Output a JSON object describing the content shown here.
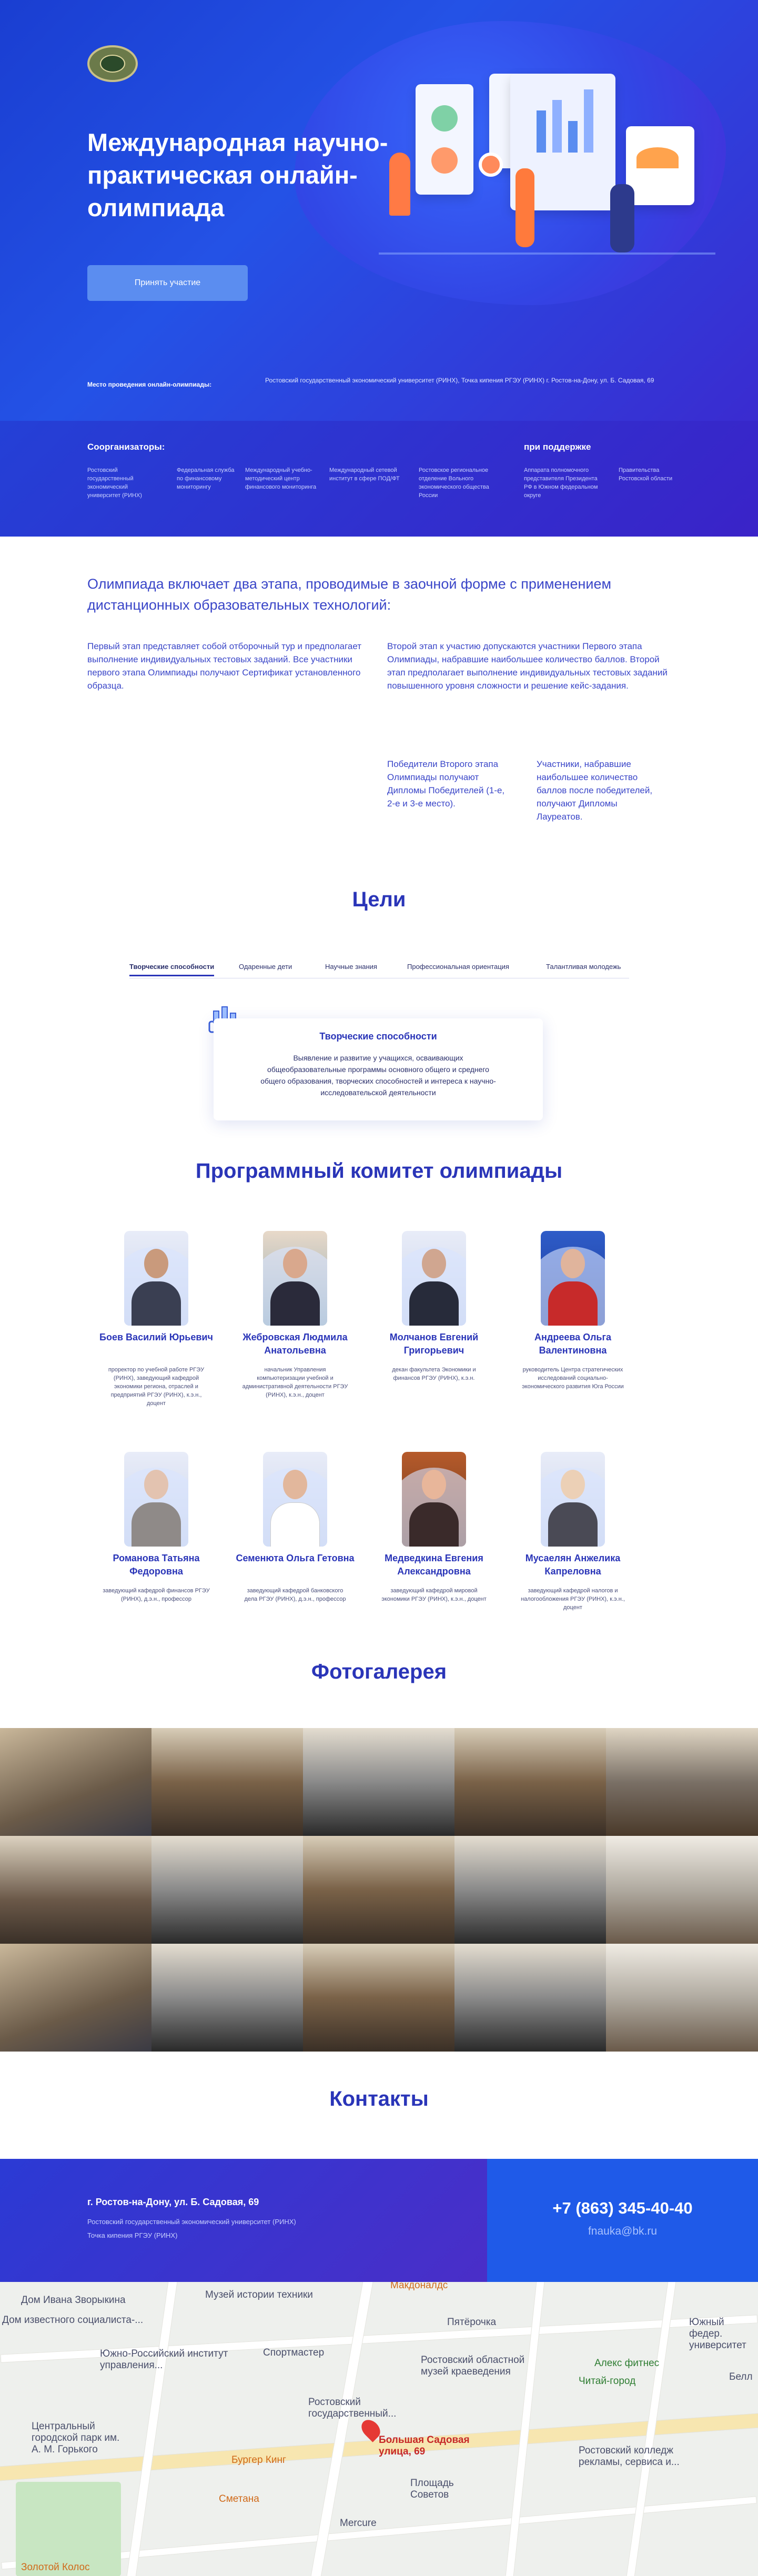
{
  "hero": {
    "title": "Международная научно-практическая онлайн-олимпиада",
    "join_button": "Принять участие",
    "venue_label": "Место проведения онлайн-олимпиады:",
    "venue_text": "Ростовский государственный экономический университет (РИНХ), Точка кипения РГЭУ (РИНХ) г. Ростов-на-Дону, ул. Б. Садовая, 69"
  },
  "organizers": {
    "title": "Соорганизаторы:",
    "items": [
      "Ростовский государственный экономический университет (РИНХ)",
      "Федеральная служба по финансовому мониторингу",
      "Международный учебно-методический центр финансового мониторинга",
      "Международный сетевой институт в сфере ПОД/ФТ",
      "Ростовское региональное отделение Вольного экономического общества России"
    ],
    "support_title": "при поддержке",
    "support_items": [
      "Аппарата полномочного представителя Президента РФ в Южном федеральном округе",
      "Правительства Ростовской области"
    ]
  },
  "intro": {
    "lead": "Олимпиада включает два этапа, проводимые в заочной форме с применением дистанционных образовательных технологий:",
    "stage1": "Первый этап представляет собой отборочный тур и предполагает выполнение индивидуальных тестовых заданий. Все участники первого этапа Олимпиады получают Сертификат установленного образца.",
    "stage2": "Второй этап к участию допускаются участники Первого этапа Олимпиады, набравшие наибольшее количество баллов. Второй этап предполагает выполнение индивидуальных тестовых заданий повышенного уровня сложности и решение кейс-задания.",
    "winners": "Победители Второго этапа Олимпиады получают Дипломы Победителей (1-е, 2-е и 3-е место).",
    "laureates": "Участники, набравшие наибольшее количество баллов после победителей, получают Дипломы Лауреатов."
  },
  "goals": {
    "title": "Цели",
    "tabs": [
      "Творческие способности",
      "Одаренные дети",
      "Научные знания",
      "Профессиональная ориентация",
      "Талантливая молодежь"
    ],
    "card_title": "Творческие способности",
    "card_text": "Выявление и развитие у учащихся, осваивающих общеобразовательные программы основного общего и среднего общего образования, творческих способностей и интереса к научно-исследовательской деятельности"
  },
  "committee": {
    "title": "Программный комитет олимпиады",
    "members": [
      {
        "name": "Боев Василий Юрьевич",
        "role": "проректор по учебной работе РГЭУ (РИНХ), заведующий кафедрой экономики региона, отраслей и предприятий РГЭУ (РИНХ), к.э.н., доцент"
      },
      {
        "name": "Жебровская Людмила Анатольевна",
        "role": "начальник Управления компьютеризации учебной и административной деятельности РГЭУ (РИНХ), к.э.н., доцент"
      },
      {
        "name": "Молчанов Евгений Григорьевич",
        "role": "декан факультета Экономики и финансов РГЭУ (РИНХ), к.э.н."
      },
      {
        "name": "Андреева Ольга Валентиновна",
        "role": "руководитель Центра стратегических исследований социально-экономического развития Юга России"
      },
      {
        "name": "Романова Татьяна Федоровна",
        "role": "заведующий кафедрой финансов РГЭУ (РИНХ), д.э.н., профессор"
      },
      {
        "name": "Семенюта Ольга Гетовна",
        "role": "заведующий кафедрой банковского дела РГЭУ (РИНХ), д.э.н., профессор"
      },
      {
        "name": "Медведкина Евгения Александровна",
        "role": "заведующий кафедрой мировой экономики РГЭУ (РИНХ), к.э.н., доцент"
      },
      {
        "name": "Мусаелян Анжелика Капреловна",
        "role": "заведующий кафедрой налогов и налогообложения РГЭУ (РИНХ), к.э.н., доцент"
      }
    ]
  },
  "gallery": {
    "title": "Фотогалерея"
  },
  "contacts": {
    "title": "Контакты",
    "address": "г. Ростов-на-Дону, ул. Б. Садовая, 69",
    "org": "Ростовский государственный экономический университет (РИНХ)",
    "point": "Точка кипения РГЭУ (РИНХ)",
    "phone": "+7 (863) 345-40-40",
    "email": "fnauka@bk.ru"
  },
  "map": {
    "labels": [
      "Дом Ивана Зворыкина",
      "Музей истории техники",
      "Макдоналдс",
      "Дом известного социалиста-...",
      "Пятёрочка",
      "Южный федер. университет",
      "Южно-Российский институт управления...",
      "Спортмастер",
      "Ростовский областной музей краеведения",
      "Алекс фитнес",
      "Читай-город",
      "Белл",
      "Центральный городской парк им. А. М. Горького",
      "Ростовский государственный...",
      "Большая Садовая улица, 69",
      "Бургер Кинг",
      "Площадь Советов",
      "Сметана",
      "Ростовский колледж рекламы, сервиса и...",
      "Mercure",
      "Золотой Колос"
    ]
  },
  "colors": {
    "brand": "#2a35b8",
    "accent": "#5b8df0",
    "hero_bg": "#2452e6"
  }
}
